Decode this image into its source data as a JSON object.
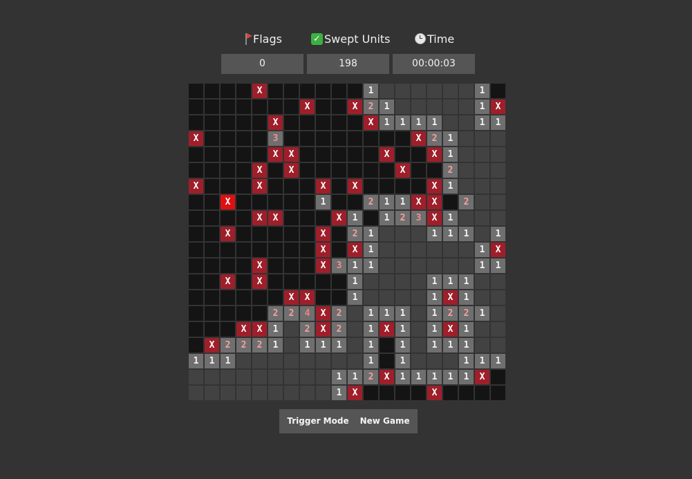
{
  "stats": {
    "flags_label": "Flags",
    "swept_label": "Swept Units",
    "time_label": "Time",
    "flags_value": "0",
    "swept_value": "198",
    "time_value": "00:00:03",
    "flag_icon": "red-flag-icon",
    "swept_icon": "green-check-icon",
    "time_icon": "clock-icon"
  },
  "board": {
    "rows": 20,
    "cols": 20,
    "legend": {
      "H": "hidden",
      "E": "empty",
      "X": "mine",
      "B": "exploded-mine",
      "1-8": "number"
    },
    "mine_text": "X",
    "grid": [
      "HHHHXHHHHHH1EEEEEE1H",
      "HHHHHHHXHHX21EEEEE1X",
      "HHHHHXHHHHHX1111EE11",
      "XHHHH3HHHHHHHHX21EEE",
      "HHHHHXXHHHHHXHHX1EEE",
      "HHHHXHXHHHHHHXHH2EEE",
      "XHHHXHHHXHXHHHHX1EEE",
      "HHBHHHHH1HH211XXH2EEE",
      "HHHHXXHHHX1H123X1EEE",
      "HHXHHHHHXH21EEE111E11",
      "HHHHHHHHXHX1EEEEEE1X",
      "HHHHXHHHX311EEEEEE11",
      "HHXHXHHHHH1EEEE111EE",
      "HHHHHHXXHH1EEEE1X1EE",
      "HHHHH22 4X2E111E1221E",
      "HHHXX1E2X2E1X1E1X1EE",
      "HX2221E111E1H1E111EE",
      "111EEEEEEEE1H1EEE111",
      "EEEEEEEEE112X11111XH",
      "EEEEEEEEE1XHHHHXHHHH"
    ]
  },
  "controls": {
    "trigger_label": "Trigger Mode",
    "new_game_label": "New Game"
  },
  "colors": {
    "background": "#333333",
    "hidden_cell": "#141414",
    "empty_cell": "#424242",
    "number_cell": "#6f6f6f",
    "mine_cell": "#9e1f2a",
    "exploded_mine": "#e01010"
  }
}
